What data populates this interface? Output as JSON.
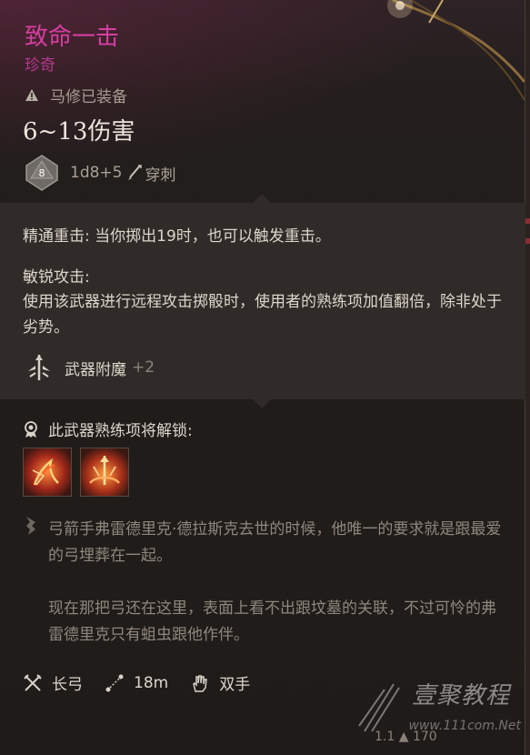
{
  "item": {
    "name": "致命一击",
    "rarity": "珍奇",
    "equipped_by": "马修已装备",
    "damage": "6~13伤害",
    "die": "8",
    "damage_roll": "1d8+5",
    "damage_type": "穿刺"
  },
  "properties": {
    "crit_line": "精通重击: 当你掷出19时，也可以触发重击。",
    "keen_title": "敏锐攻击:",
    "keen_desc": "使用该武器进行远程攻击掷骰时，使用者的熟练项加值翻倍，除非处于劣势。",
    "enchant_label": "武器附魔",
    "enchant_bonus": "+2"
  },
  "proficiency": {
    "unlock_label": "此武器熟练项将解锁:",
    "actions": [
      "flame-bow-action-icon",
      "arrow-burst-action-icon"
    ]
  },
  "lore": {
    "p1": "弓箭手弗雷德里克·德拉斯克去世的时候，他唯一的要求就是跟最爱的弓埋葬在一起。",
    "p2": "现在那把弓还在这里，表面上看不出跟坟墓的关联，不过可怜的弗雷德里克只有蛆虫跟他作伴。"
  },
  "footer": {
    "weapon_type": "长弓",
    "range": "18m",
    "handedness": "双手"
  },
  "meta": {
    "weight_value": "1.1",
    "gold_value": "170"
  },
  "watermark": {
    "brand": "壹聚教程",
    "url": "www.111com.Net"
  },
  "colors": {
    "title": "#d63ea2",
    "rarity": "#b73a8e",
    "panel_bg": "#201c1a",
    "section_bg": "#302b28"
  }
}
